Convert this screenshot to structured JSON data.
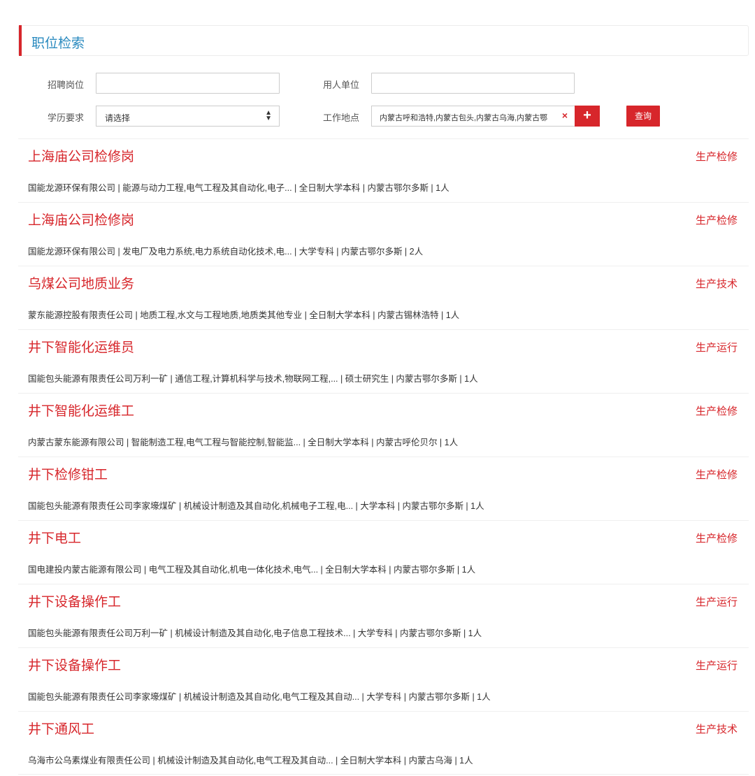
{
  "header": {
    "title": "职位检索"
  },
  "form": {
    "position_label": "招聘岗位",
    "position_value": "",
    "employer_label": "用人单位",
    "employer_value": "",
    "education_label": "学历要求",
    "education_value": "请选择",
    "location_label": "工作地点",
    "location_value": "内蒙古呼和浩特,内蒙古包头,内蒙古乌海,内蒙古鄂",
    "clear_icon": "×",
    "add_icon": "+",
    "search_label": "查询"
  },
  "jobs": [
    {
      "title": "上海庙公司检修岗",
      "category": "生产检修",
      "meta": "国能龙源环保有限公司 | 能源与动力工程,电气工程及其自动化,电子... | 全日制大学本科 | 内蒙古鄂尔多斯 | 1人"
    },
    {
      "title": "上海庙公司检修岗",
      "category": "生产检修",
      "meta": "国能龙源环保有限公司 | 发电厂及电力系统,电力系统自动化技术,电... | 大学专科 | 内蒙古鄂尔多斯 | 2人"
    },
    {
      "title": "乌煤公司地质业务",
      "category": "生产技术",
      "meta": "蒙东能源控股有限责任公司 | 地质工程,水文与工程地质,地质类其他专业 | 全日制大学本科 | 内蒙古锡林浩特 | 1人"
    },
    {
      "title": "井下智能化运维员",
      "category": "生产运行",
      "meta": "国能包头能源有限责任公司万利一矿 | 通信工程,计算机科学与技术,物联网工程,... | 硕士研究生 | 内蒙古鄂尔多斯 | 1人"
    },
    {
      "title": "井下智能化运维工",
      "category": "生产检修",
      "meta": "内蒙古蒙东能源有限公司 | 智能制造工程,电气工程与智能控制,智能监... | 全日制大学本科 | 内蒙古呼伦贝尔 | 1人"
    },
    {
      "title": "井下检修钳工",
      "category": "生产检修",
      "meta": "国能包头能源有限责任公司李家壕煤矿 | 机械设计制造及其自动化,机械电子工程,电... | 大学本科 | 内蒙古鄂尔多斯 | 1人"
    },
    {
      "title": "井下电工",
      "category": "生产检修",
      "meta": "国电建投内蒙古能源有限公司 | 电气工程及其自动化,机电一体化技术,电气... | 全日制大学本科 | 内蒙古鄂尔多斯 | 1人"
    },
    {
      "title": "井下设备操作工",
      "category": "生产运行",
      "meta": "国能包头能源有限责任公司万利一矿 | 机械设计制造及其自动化,电子信息工程技术... | 大学专科 | 内蒙古鄂尔多斯 | 1人"
    },
    {
      "title": "井下设备操作工",
      "category": "生产运行",
      "meta": "国能包头能源有限责任公司李家壕煤矿 | 机械设计制造及其自动化,电气工程及其自动... | 大学专科 | 内蒙古鄂尔多斯 | 1人"
    },
    {
      "title": "井下通风工",
      "category": "生产技术",
      "meta": "乌海市公乌素煤业有限责任公司 | 机械设计制造及其自动化,电气工程及其自动... | 全日制大学本科 | 内蒙古乌海 | 1人"
    }
  ],
  "colors": {
    "accent": "#d7262b",
    "title_blue": "#2a8abf"
  }
}
